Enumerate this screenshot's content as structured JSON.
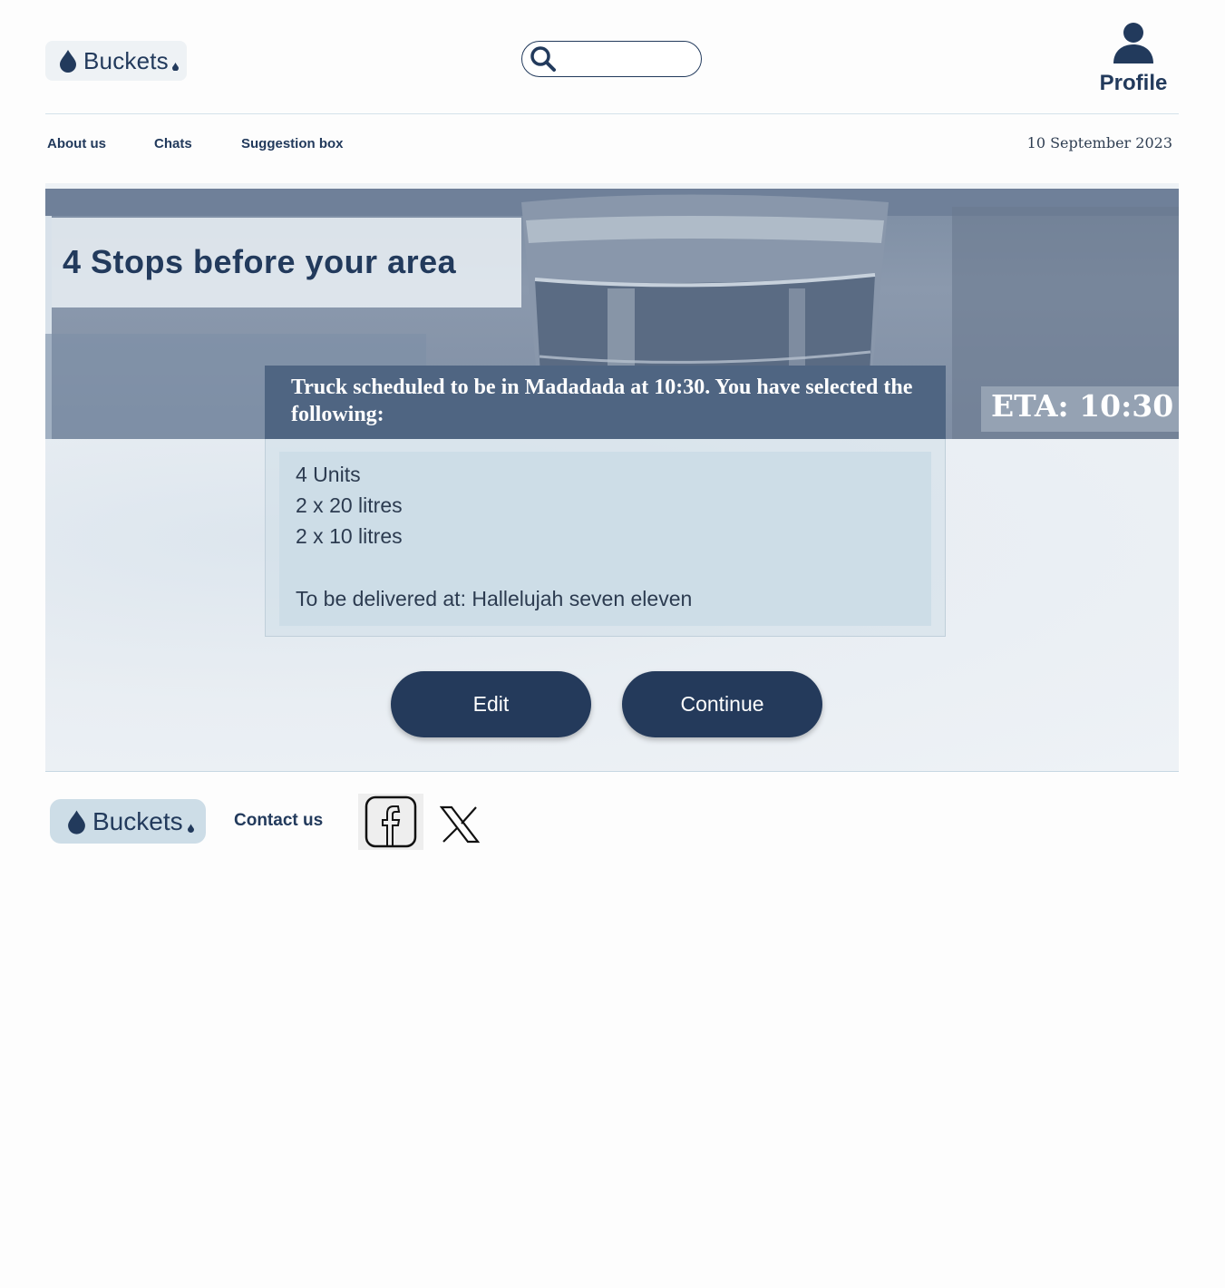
{
  "header": {
    "brand": "Buckets",
    "search": {
      "value": "",
      "placeholder": ""
    },
    "profile_label": "Profile"
  },
  "nav": {
    "items": [
      "About us",
      "Chats",
      "Suggestion box"
    ],
    "date": "10 September 2023"
  },
  "hero": {
    "title": "4 Stops before your area",
    "eta": "ETA: 10:30"
  },
  "summary": {
    "heading": "Truck scheduled to be in Madadada at 10:30. You have selected the following:",
    "lines": [
      "4 Units",
      "2 x 20 litres",
      "2 x 10 litres"
    ],
    "delivery": "To be delivered at: Hallelujah seven eleven"
  },
  "actions": {
    "edit": "Edit",
    "continue": "Continue"
  },
  "footer": {
    "brand": "Buckets",
    "contact": "Contact us",
    "social_icons": [
      "facebook-icon",
      "x-icon"
    ]
  },
  "colors": {
    "brand_navy": "#243a5b",
    "modal_header": "#4f6582",
    "panel": "#cddde7"
  }
}
